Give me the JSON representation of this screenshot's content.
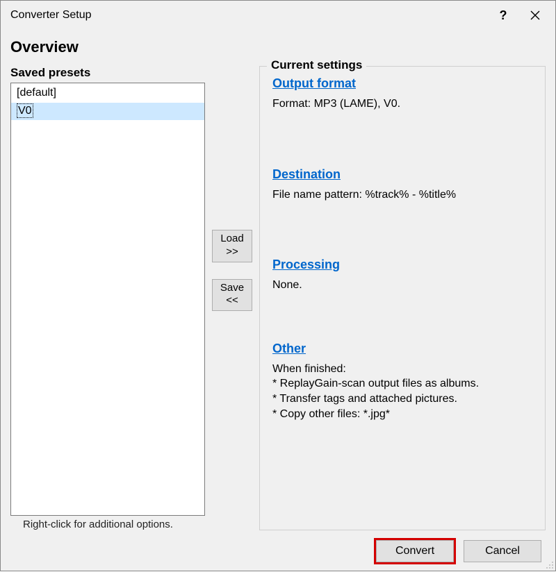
{
  "window": {
    "title": "Converter Setup"
  },
  "overview": "Overview",
  "presets": {
    "label": "Saved presets",
    "items": [
      "[default]",
      "V0"
    ],
    "selected_index": 1,
    "hint": "Right-click for additional options."
  },
  "buttons": {
    "load": "Load >>",
    "save": "Save <<",
    "convert": "Convert",
    "cancel": "Cancel"
  },
  "settings": {
    "label": "Current settings",
    "output_format": {
      "heading": "Output format",
      "text": "Format: MP3 (LAME), V0."
    },
    "destination": {
      "heading": "Destination",
      "text": "File name pattern: %track% - %title%"
    },
    "processing": {
      "heading": "Processing",
      "text": "None."
    },
    "other": {
      "heading": "Other",
      "lines": [
        "When finished:",
        "* ReplayGain-scan output files as albums.",
        "* Transfer tags and attached pictures.",
        "* Copy other files: *.jpg*"
      ]
    }
  }
}
